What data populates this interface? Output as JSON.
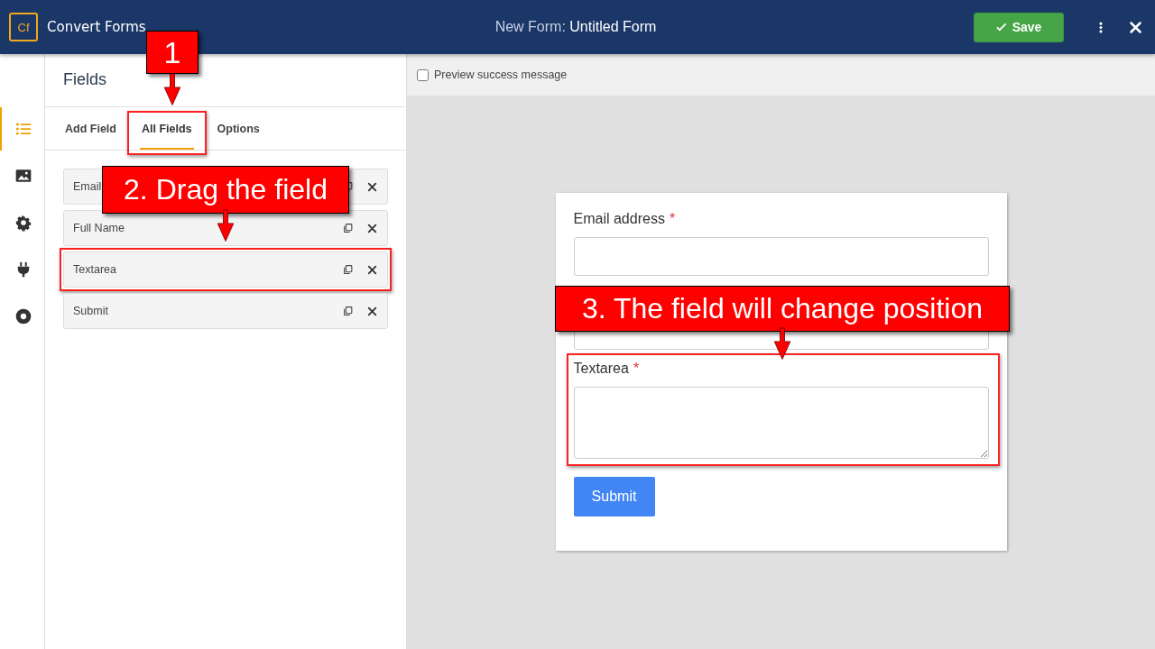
{
  "header": {
    "app_name": "Convert Forms",
    "logo_text": "Cf",
    "title": "New Form: **Untitled Form**",
    "save_label": "Save"
  },
  "rail": [
    {
      "selected": true
    },
    {
      "selected": false
    },
    {
      "selected": false
    },
    {
      "selected": false
    },
    {
      "selected": false
    }
  ],
  "panel": {
    "title": "Fields",
    "tabs": [
      {
        "label": "Add Field",
        "selected": false,
        "highlighted": false
      },
      {
        "label": "All Fields",
        "selected": true,
        "highlighted": true
      },
      {
        "label": "Options",
        "selected": false,
        "highlighted": false
      }
    ],
    "fields": [
      {
        "label": "Email",
        "highlighted": false
      },
      {
        "label": "Full Name",
        "highlighted": false
      },
      {
        "label": "Textarea",
        "highlighted": true
      },
      {
        "label": "Submit",
        "highlighted": false
      }
    ]
  },
  "preview": {
    "checkbox": {
      "label": "Preview success message",
      "checked": false
    },
    "form": {
      "fields": [
        {
          "kind": "input",
          "label": "Email address",
          "required_mark": "*",
          "highlighted": false
        },
        {
          "kind": "input",
          "highlighted": false
        },
        {
          "kind": "textarea",
          "label": "Textarea",
          "required_mark": "*",
          "highlighted": true
        }
      ],
      "submit_label": "Submit"
    }
  },
  "callouts": [
    {
      "text": "1"
    },
    {
      "text": "2. Drag the field"
    },
    {
      "text": "3. The field will change position"
    }
  ]
}
